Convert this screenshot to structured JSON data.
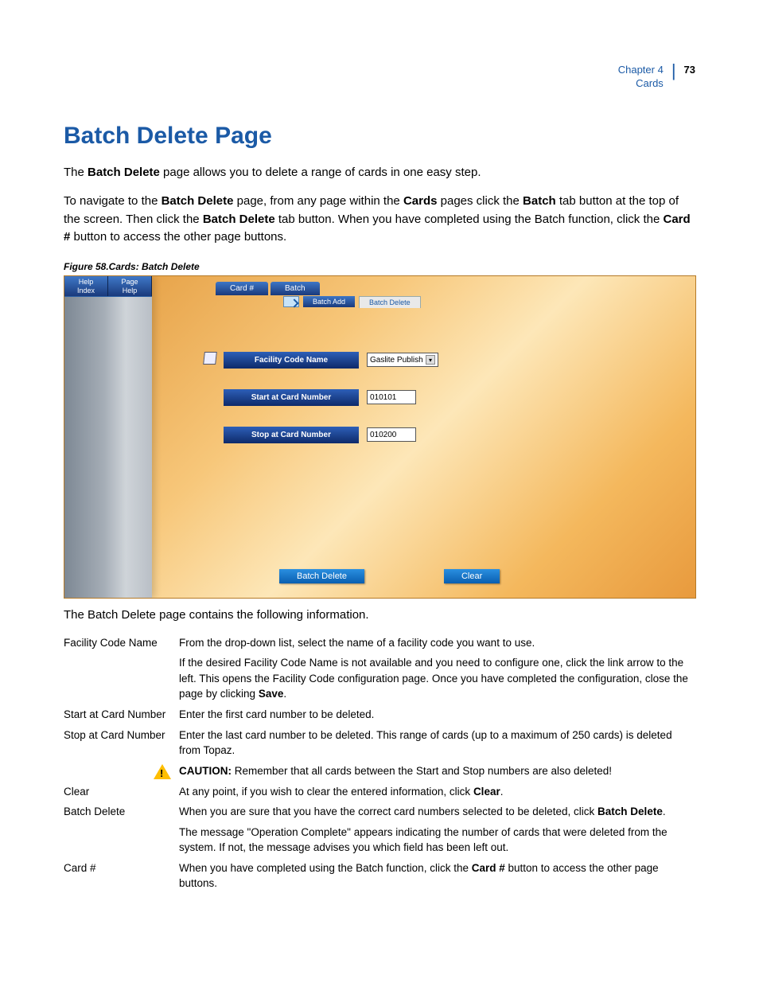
{
  "header": {
    "chapter_line": "Chapter 4",
    "section_line": "Cards",
    "page_number": "73"
  },
  "title": "Batch Delete Page",
  "intro_paragraphs": {
    "p1_pre": "The ",
    "p1_b1": "Batch Delete",
    "p1_post": " page allows you to delete a range of cards in one easy step.",
    "p2_a": "To navigate to the ",
    "p2_b1": "Batch Delete",
    "p2_b": " page, from any page within the ",
    "p2_b2": "Cards",
    "p2_c": " pages click the ",
    "p2_b3": "Batch",
    "p2_d": " tab button at the top of the screen. Then click the ",
    "p2_b4": "Batch Delete",
    "p2_e": " tab button. When you have completed using the Batch function, click the ",
    "p2_b5": "Card #",
    "p2_f": " button to access the other page buttons."
  },
  "figure_caption": "Figure 58.Cards: Batch Delete",
  "screenshot": {
    "sidebar": {
      "help": "Help\nIndex",
      "page_help": "Page\nHelp"
    },
    "tabs": {
      "card_num": "Card #",
      "batch": "Batch"
    },
    "subtabs": {
      "add": "Batch Add",
      "delete": "Batch Delete"
    },
    "form": {
      "facility_label": "Facility Code Name",
      "facility_value": "Gaslite Publish",
      "start_label": "Start at Card Number",
      "start_value": "010101",
      "stop_label": "Stop at Card Number",
      "stop_value": "010200"
    },
    "buttons": {
      "batch_delete": "Batch Delete",
      "clear": "Clear"
    }
  },
  "section_lead": "The Batch Delete page contains the following information.",
  "rows": {
    "facility": {
      "term": "Facility Code Name",
      "d1": "From the drop-down list, select the name of a facility code you want to use.",
      "d2a": "If the desired Facility Code Name is not available and you need to configure one, click the link arrow to the left. This opens the Facility Code configuration page. Once you have completed the configuration, close the page by clicking ",
      "d2b": "Save",
      "d2c": "."
    },
    "start": {
      "term": "Start at Card Number",
      "d": "Enter the first card number to be deleted."
    },
    "stop": {
      "term": "Stop at Card Number",
      "d": "Enter the last card number to be deleted. This range of cards (up to a maximum of 250 cards) is deleted from Topaz."
    },
    "caution": {
      "label": "CAUTION:",
      "text": "  Remember that all cards between the Start and Stop numbers are also deleted!"
    },
    "clear": {
      "term": "Clear",
      "d1": "At any point, if you wish to clear the entered information, click ",
      "d1b": "Clear",
      "d1c": "."
    },
    "batch_delete": {
      "term": "Batch Delete",
      "d1": "When you are sure that you have the correct card numbers selected to be deleted, click ",
      "d1b": "Batch Delete",
      "d1c": ".",
      "d2": "The message \"Operation Complete\" appears indicating the number of cards that were deleted from the system. If not, the message advises you which field has been left out."
    },
    "card_num": {
      "term": "Card #",
      "d1": "When you have completed using the Batch function, click the ",
      "d1b": "Card #",
      "d1c": " button to access the other page buttons."
    }
  }
}
